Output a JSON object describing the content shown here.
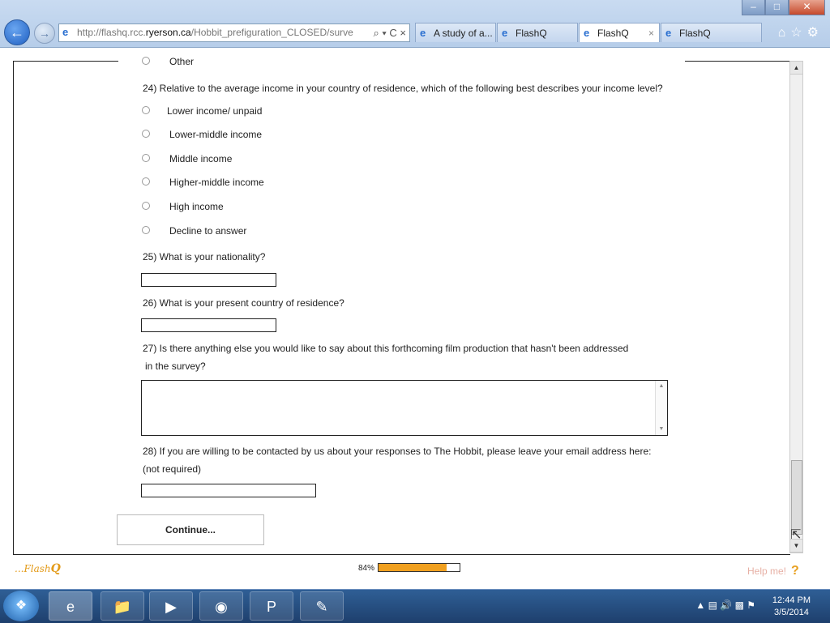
{
  "browser": {
    "address_prefix": "http://flashq.rcc.",
    "address_domain": "ryerson.ca",
    "address_path": "/Hobbit_prefiguration_CLOSED/surve",
    "address_tools": "⌕ ▾ C ×",
    "tabs": [
      {
        "label": "A study of a...",
        "active": false
      },
      {
        "label": "FlashQ",
        "active": false
      },
      {
        "label": "FlashQ",
        "active": true
      },
      {
        "label": "FlashQ",
        "active": false
      }
    ],
    "tab_close": "×",
    "right_icons": "⌂☆⚙"
  },
  "survey": {
    "prev_option": "Other",
    "q24": "24) Relative to the average income in your country of residence, which of the following best describes your income level?",
    "q24_options": [
      "Lower income/ unpaid",
      "Lower-middle income",
      "Middle income",
      "Higher-middle income",
      "High income",
      "Decline to answer"
    ],
    "q25": "25) What is your nationality?",
    "q26": "26) What is your present country of residence?",
    "q27_line1": "27) Is there anything else you would like to say about this forthcoming film production that hasn't been addressed",
    "q27_line2": "in the survey?",
    "q28_line1": "28) If you are willing to be contacted by us about your responses to The Hobbit, please leave your email address here:",
    "q28_line2": "(not required)",
    "continue_label": "Continue..."
  },
  "footer": {
    "logo_prefix": "...Flash",
    "logo_q": "Q",
    "progress_label": "84%",
    "progress_value": 0.84,
    "help_label": "Help me!",
    "help_icon": "?"
  },
  "taskbar": {
    "time": "12:44 PM",
    "date": "3/5/2014"
  },
  "colors": {
    "accent": "#f0a020",
    "chrome": "#c9dbf1",
    "taskbar": "#1e3f6d"
  }
}
